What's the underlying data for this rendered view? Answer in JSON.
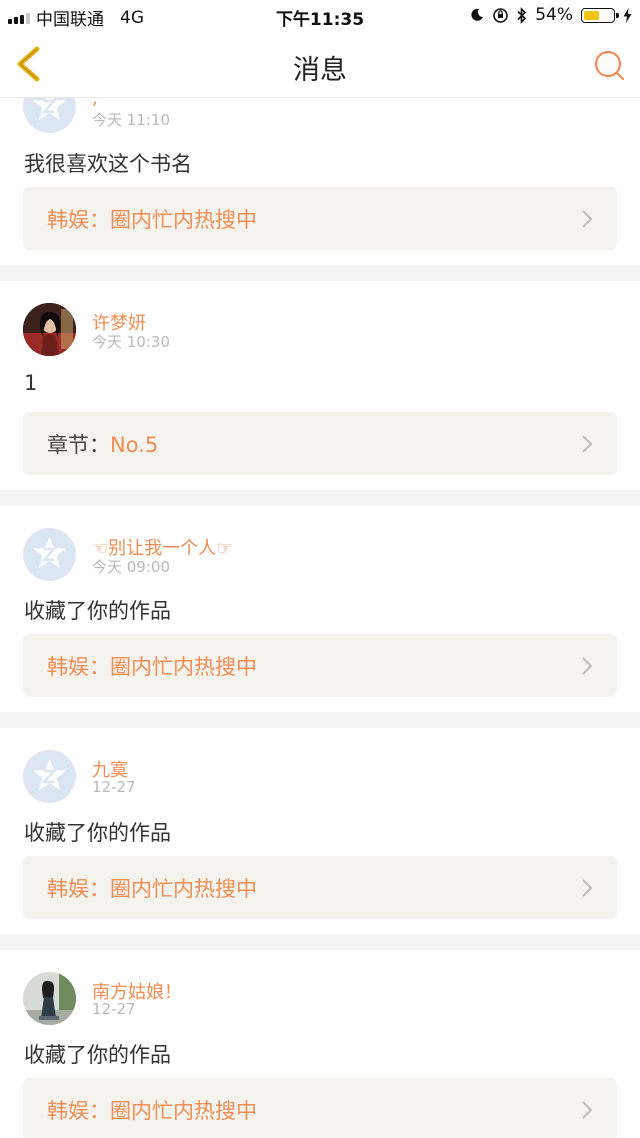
{
  "status_bar": {
    "carrier": "中国联通",
    "network": "4G",
    "time": "下午11:35",
    "battery_text": "54%",
    "battery_level": 0.54
  },
  "nav": {
    "title": "消息"
  },
  "messages": [
    {
      "username": ",",
      "time": "今天 11:10",
      "content": "我很喜欢这个书名",
      "ref_label": "",
      "ref_text": "韩娱：圈内忙内热搜中"
    },
    {
      "username": "许梦妍",
      "time": "今天 10:30",
      "content": "1",
      "ref_label": "章节：",
      "ref_text": "No.5"
    },
    {
      "username": "☜别让我一个人☞",
      "time": "今天 09:00",
      "content": "收藏了你的作品",
      "ref_label": "",
      "ref_text": "韩娱：圈内忙内热搜中"
    },
    {
      "username": "九寞",
      "time": "12-27",
      "content": "收藏了你的作品",
      "ref_label": "",
      "ref_text": "韩娱：圈内忙内热搜中"
    },
    {
      "username": "南方姑娘！",
      "time": "12-27",
      "content": "收藏了你的作品",
      "ref_label": "",
      "ref_text": "韩娱：圈内忙内热搜中"
    }
  ],
  "colors": {
    "accent": "#f08d54",
    "back_icon": "#e7b21c",
    "ref_background": "#f4f3ee"
  }
}
